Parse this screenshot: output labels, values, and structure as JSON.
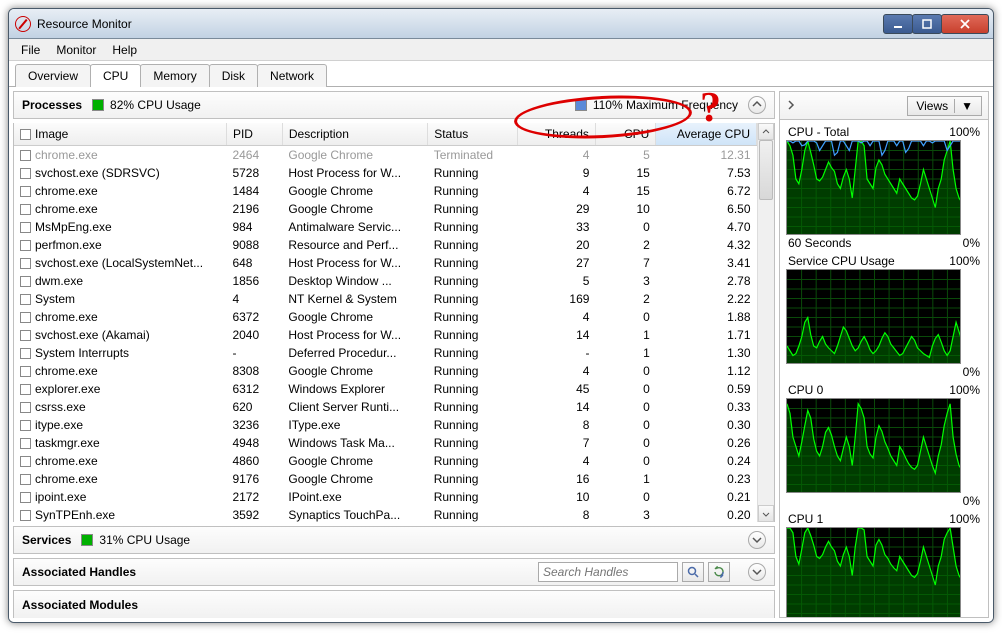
{
  "window": {
    "title": "Resource Monitor"
  },
  "menu": {
    "file": "File",
    "monitor": "Monitor",
    "help": "Help"
  },
  "tabs": {
    "overview": "Overview",
    "cpu": "CPU",
    "memory": "Memory",
    "disk": "Disk",
    "network": "Network"
  },
  "processes": {
    "title": "Processes",
    "usage_label": "82% CPU Usage",
    "usage_color": "#00b000",
    "freq_label": "110% Maximum Frequency",
    "freq_color": "#5a8ad8",
    "columns": {
      "image": "Image",
      "pid": "PID",
      "desc": "Description",
      "status": "Status",
      "threads": "Threads",
      "cpu": "CPU",
      "avg": "Average CPU"
    },
    "rows": [
      {
        "image": "chrome.exe",
        "pid": "2464",
        "desc": "Google Chrome",
        "status": "Terminated",
        "threads": "4",
        "cpu": "5",
        "avg": "12.31",
        "terminated": true
      },
      {
        "image": "svchost.exe (SDRSVC)",
        "pid": "5728",
        "desc": "Host Process for W...",
        "status": "Running",
        "threads": "9",
        "cpu": "15",
        "avg": "7.53"
      },
      {
        "image": "chrome.exe",
        "pid": "1484",
        "desc": "Google Chrome",
        "status": "Running",
        "threads": "4",
        "cpu": "15",
        "avg": "6.72"
      },
      {
        "image": "chrome.exe",
        "pid": "2196",
        "desc": "Google Chrome",
        "status": "Running",
        "threads": "29",
        "cpu": "10",
        "avg": "6.50"
      },
      {
        "image": "MsMpEng.exe",
        "pid": "984",
        "desc": "Antimalware Servic...",
        "status": "Running",
        "threads": "33",
        "cpu": "0",
        "avg": "4.70"
      },
      {
        "image": "perfmon.exe",
        "pid": "9088",
        "desc": "Resource and Perf...",
        "status": "Running",
        "threads": "20",
        "cpu": "2",
        "avg": "4.32"
      },
      {
        "image": "svchost.exe (LocalSystemNet...",
        "pid": "648",
        "desc": "Host Process for W...",
        "status": "Running",
        "threads": "27",
        "cpu": "7",
        "avg": "3.41"
      },
      {
        "image": "dwm.exe",
        "pid": "1856",
        "desc": "Desktop Window ...",
        "status": "Running",
        "threads": "5",
        "cpu": "3",
        "avg": "2.78"
      },
      {
        "image": "System",
        "pid": "4",
        "desc": "NT Kernel & System",
        "status": "Running",
        "threads": "169",
        "cpu": "2",
        "avg": "2.22"
      },
      {
        "image": "chrome.exe",
        "pid": "6372",
        "desc": "Google Chrome",
        "status": "Running",
        "threads": "4",
        "cpu": "0",
        "avg": "1.88"
      },
      {
        "image": "svchost.exe (Akamai)",
        "pid": "2040",
        "desc": "Host Process for W...",
        "status": "Running",
        "threads": "14",
        "cpu": "1",
        "avg": "1.71"
      },
      {
        "image": "System Interrupts",
        "pid": "-",
        "desc": "Deferred Procedur...",
        "status": "Running",
        "threads": "-",
        "cpu": "1",
        "avg": "1.30"
      },
      {
        "image": "chrome.exe",
        "pid": "8308",
        "desc": "Google Chrome",
        "status": "Running",
        "threads": "4",
        "cpu": "0",
        "avg": "1.12"
      },
      {
        "image": "explorer.exe",
        "pid": "6312",
        "desc": "Windows Explorer",
        "status": "Running",
        "threads": "45",
        "cpu": "0",
        "avg": "0.59"
      },
      {
        "image": "csrss.exe",
        "pid": "620",
        "desc": "Client Server Runti...",
        "status": "Running",
        "threads": "14",
        "cpu": "0",
        "avg": "0.33"
      },
      {
        "image": "itype.exe",
        "pid": "3236",
        "desc": "IType.exe",
        "status": "Running",
        "threads": "8",
        "cpu": "0",
        "avg": "0.30"
      },
      {
        "image": "taskmgr.exe",
        "pid": "4948",
        "desc": "Windows Task Ma...",
        "status": "Running",
        "threads": "7",
        "cpu": "0",
        "avg": "0.26"
      },
      {
        "image": "chrome.exe",
        "pid": "4860",
        "desc": "Google Chrome",
        "status": "Running",
        "threads": "4",
        "cpu": "0",
        "avg": "0.24"
      },
      {
        "image": "chrome.exe",
        "pid": "9176",
        "desc": "Google Chrome",
        "status": "Running",
        "threads": "16",
        "cpu": "1",
        "avg": "0.23"
      },
      {
        "image": "ipoint.exe",
        "pid": "2172",
        "desc": "IPoint.exe",
        "status": "Running",
        "threads": "10",
        "cpu": "0",
        "avg": "0.21"
      },
      {
        "image": "SynTPEnh.exe",
        "pid": "3592",
        "desc": "Synaptics TouchPa...",
        "status": "Running",
        "threads": "8",
        "cpu": "3",
        "avg": "0.20"
      }
    ]
  },
  "services": {
    "title": "Services",
    "usage_label": "31% CPU Usage"
  },
  "handles": {
    "title": "Associated Handles",
    "placeholder": "Search Handles"
  },
  "modules": {
    "title": "Associated Modules"
  },
  "right": {
    "views": "Views"
  },
  "charts": {
    "total": {
      "title": "CPU - Total",
      "right": "100%",
      "foot_left": "60 Seconds",
      "foot_right": "0%"
    },
    "service": {
      "title": "Service CPU Usage",
      "right": "100%",
      "foot_right": "0%"
    },
    "cpu0": {
      "title": "CPU 0",
      "right": "100%",
      "foot_right": "0%"
    },
    "cpu1": {
      "title": "CPU 1",
      "right": "100%"
    }
  },
  "chart_data": [
    {
      "type": "line",
      "title": "CPU - Total",
      "ylim": [
        0,
        100
      ],
      "x_seconds": 60,
      "series": [
        {
          "name": "usage",
          "values": [
            100,
            95,
            85,
            60,
            55,
            70,
            90,
            100,
            88,
            75,
            60,
            58,
            62,
            70,
            78,
            72,
            68,
            55,
            50,
            62,
            70,
            60,
            40,
            70,
            100,
            100,
            95,
            60,
            55,
            50,
            72,
            80,
            75,
            65,
            60,
            55,
            50,
            45,
            60,
            55,
            50,
            45,
            40,
            38,
            42,
            55,
            70,
            60,
            50,
            40,
            30,
            50,
            60,
            80,
            90,
            100,
            70,
            50,
            40,
            35
          ]
        },
        {
          "name": "max_frequency",
          "values": [
            100,
            100,
            98,
            100,
            100,
            95,
            96,
            100,
            100,
            100,
            98,
            90,
            95,
            100,
            100,
            100,
            85,
            88,
            100,
            100,
            95,
            90,
            100,
            100,
            100,
            98,
            100,
            100,
            95,
            100,
            100,
            100,
            85,
            90,
            100,
            100,
            100,
            95,
            100,
            100,
            88,
            92,
            100,
            100,
            100,
            100,
            95,
            100,
            100,
            98,
            100,
            100,
            100,
            100,
            90,
            95,
            100,
            100,
            100,
            100
          ]
        }
      ]
    },
    {
      "type": "line",
      "title": "Service CPU Usage",
      "ylim": [
        0,
        100
      ],
      "x_seconds": 60,
      "series": [
        {
          "name": "usage",
          "values": [
            20,
            15,
            10,
            12,
            20,
            30,
            45,
            50,
            32,
            20,
            18,
            25,
            30,
            22,
            18,
            15,
            12,
            20,
            30,
            40,
            36,
            28,
            20,
            15,
            18,
            25,
            30,
            24,
            16,
            12,
            15,
            20,
            28,
            34,
            30,
            22,
            18,
            14,
            10,
            12,
            18,
            24,
            30,
            26,
            18,
            15,
            12,
            10,
            8,
            20,
            28,
            32,
            24,
            15,
            10,
            15,
            30,
            45,
            35,
            25
          ]
        }
      ]
    },
    {
      "type": "line",
      "title": "CPU 0",
      "ylim": [
        0,
        100
      ],
      "x_seconds": 60,
      "series": [
        {
          "name": "usage",
          "values": [
            95,
            85,
            60,
            50,
            40,
            55,
            72,
            88,
            80,
            58,
            45,
            40,
            50,
            65,
            70,
            62,
            50,
            40,
            35,
            48,
            60,
            50,
            30,
            60,
            95,
            90,
            80,
            50,
            42,
            38,
            60,
            72,
            66,
            55,
            48,
            40,
            35,
            30,
            50,
            45,
            38,
            32,
            28,
            26,
            30,
            45,
            60,
            50,
            40,
            30,
            22,
            40,
            52,
            72,
            85,
            95,
            60,
            42,
            30,
            25
          ]
        }
      ]
    },
    {
      "type": "line",
      "title": "CPU 1",
      "ylim": [
        0,
        100
      ],
      "x_seconds": 60,
      "series": [
        {
          "name": "usage",
          "values": [
            100,
            100,
            95,
            70,
            62,
            78,
            95,
            100,
            92,
            82,
            70,
            68,
            72,
            80,
            86,
            80,
            76,
            65,
            60,
            72,
            80,
            70,
            50,
            80,
            100,
            100,
            98,
            70,
            65,
            60,
            82,
            88,
            82,
            72,
            68,
            62,
            58,
            55,
            70,
            65,
            60,
            55,
            50,
            48,
            52,
            65,
            80,
            70,
            60,
            50,
            40,
            60,
            70,
            88,
            95,
            100,
            80,
            60,
            50,
            45
          ]
        }
      ]
    }
  ]
}
